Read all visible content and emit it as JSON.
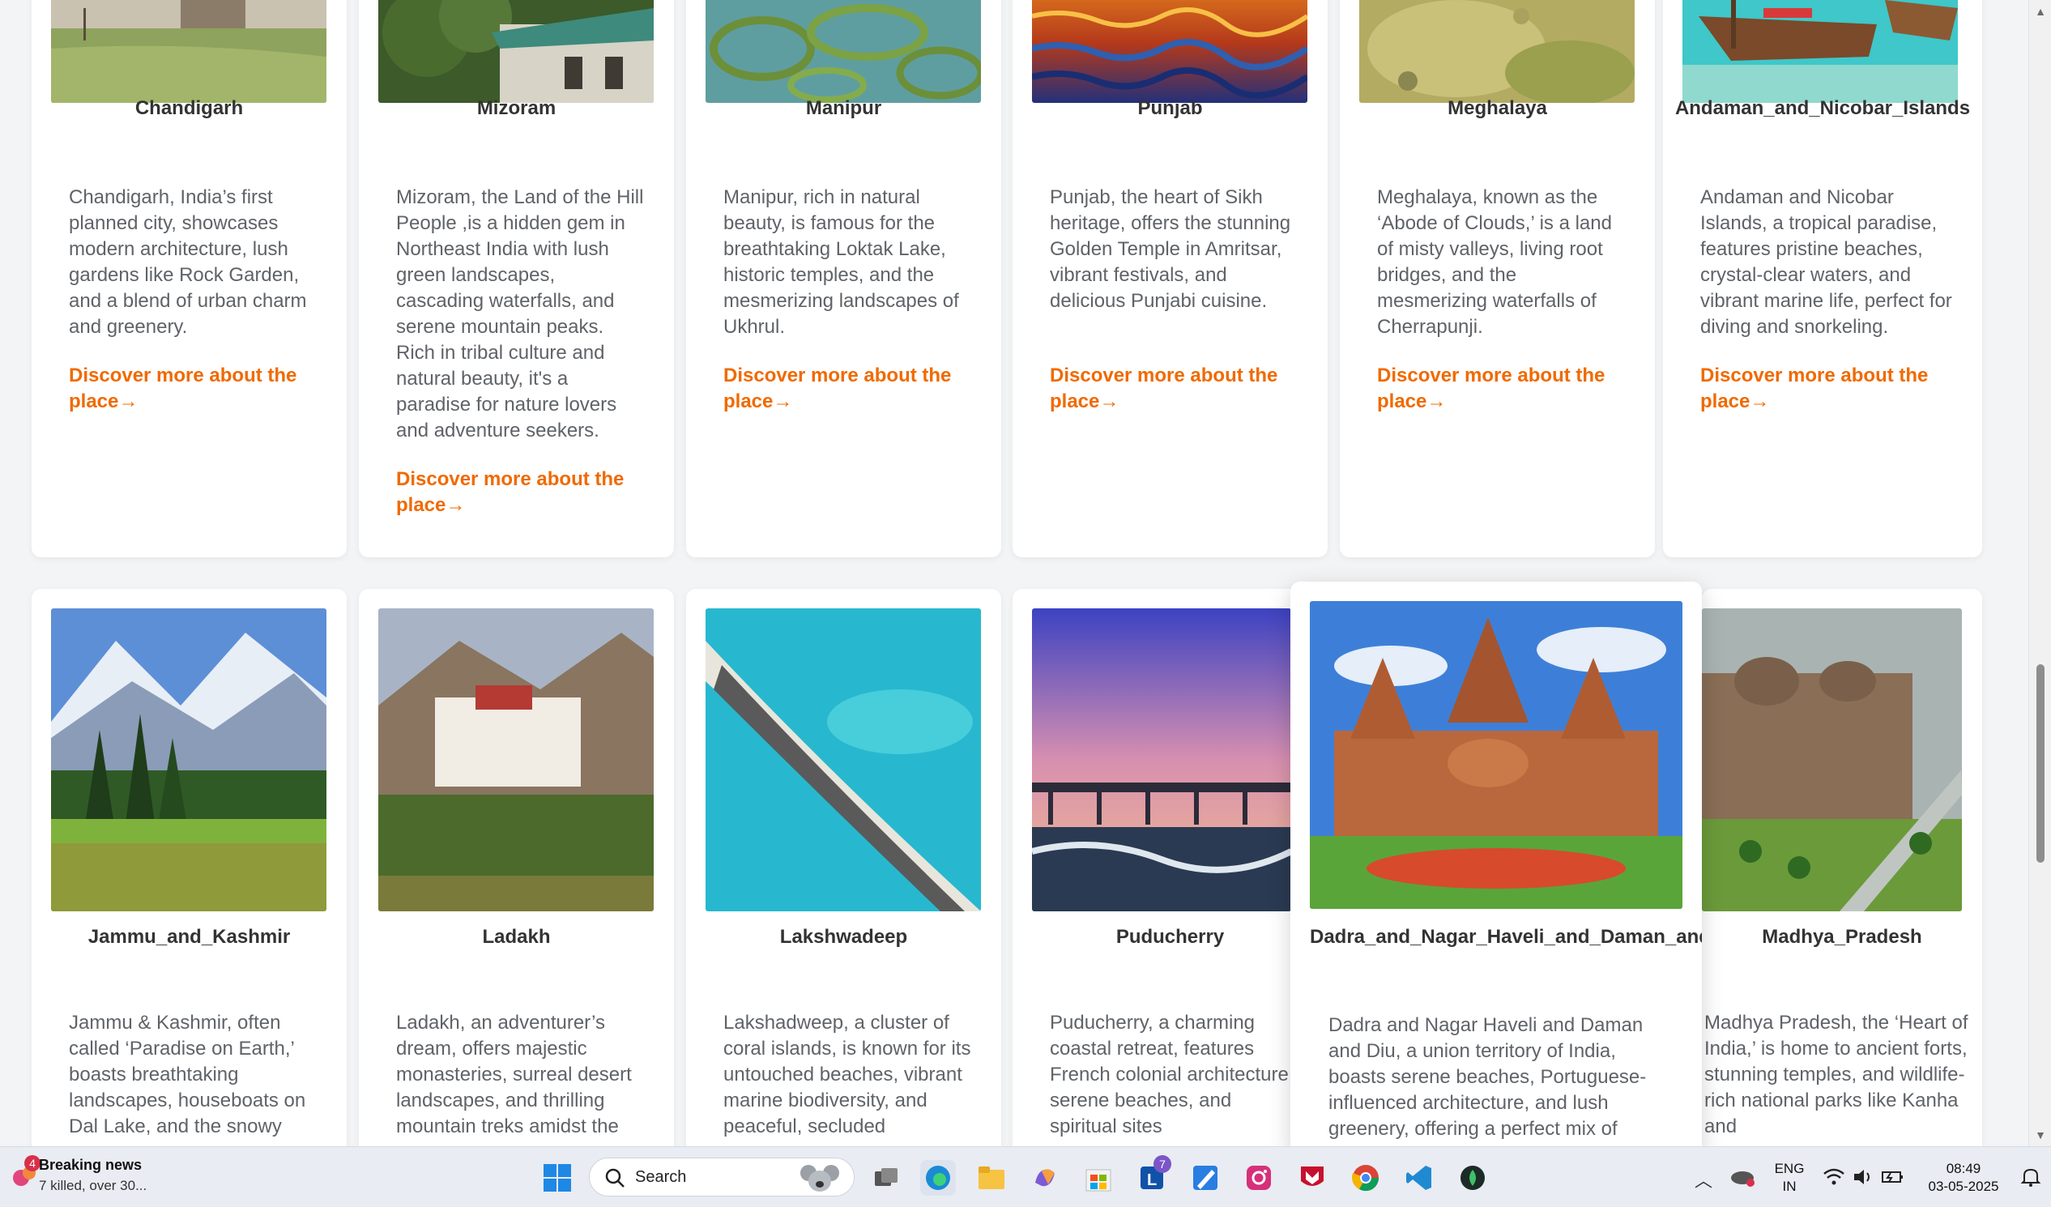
{
  "cards_row1": [
    {
      "title": "Chandigarh",
      "desc": "Chandigarh, India’s first planned city, showcases modern architecture, lush gardens like Rock Garden, and a blend of urban charm and greenery.",
      "link": "Discover more about the place→"
    },
    {
      "title": "Mizoram",
      "desc": "Mizoram, the Land of the Hill People ,is a hidden gem in Northeast India with lush green landscapes, cascading waterfalls, and serene mountain peaks. Rich in tribal culture and natural beauty, it's a paradise for nature lovers and adventure seekers.",
      "link": "Discover more about the place→"
    },
    {
      "title": "Manipur",
      "desc": "Manipur, rich in natural beauty, is famous for the breathtaking Loktak Lake, historic temples, and the mesmerizing landscapes of Ukhrul.",
      "link": "Discover more about the place→"
    },
    {
      "title": "Punjab",
      "desc": "Punjab, the heart of Sikh heritage, offers the stunning Golden Temple in Amritsar, vibrant festivals, and delicious Punjabi cuisine.",
      "link": "Discover more about the place→"
    },
    {
      "title": "Meghalaya",
      "desc": "Meghalaya, known as the ‘Abode of Clouds,’ is a land of misty valleys, living root bridges, and the mesmerizing waterfalls of Cherrapunji.",
      "link": "Discover more about the place→"
    },
    {
      "title": "Andaman_and_Nicobar_Islands",
      "desc": "Andaman and Nicobar Islands, a tropical paradise, features pristine beaches, crystal-clear waters, and vibrant marine life, perfect for diving and snorkeling.",
      "link": "Discover more about the place→"
    }
  ],
  "cards_row2": [
    {
      "title": "Jammu_and_Kashmir",
      "desc": "Jammu & Kashmir, often called ‘Paradise on Earth,’ boasts breathtaking landscapes, houseboats on Dal Lake, and the snowy"
    },
    {
      "title": "Ladakh",
      "desc": "Ladakh, an adventurer’s dream, offers majestic monasteries, surreal desert landscapes, and thrilling mountain treks amidst the"
    },
    {
      "title": "Lakshwadeep",
      "desc": "Lakshadweep, a cluster of coral islands, is known for its untouched beaches, vibrant marine biodiversity, and peaceful, secluded"
    },
    {
      "title": "Puducherry",
      "desc": "Puducherry, a charming coastal retreat, features French colonial architecture, serene beaches, and spiritual sites"
    },
    {
      "title": "Dadra_and_Nagar_Haveli_and_Daman_and",
      "desc": "Dadra and Nagar Haveli and Daman and Diu, a union territory of India, boasts serene beaches, Portuguese-influenced architecture, and lush greenery, offering a perfect mix of"
    },
    {
      "title": "Madhya_Pradesh",
      "desc": "Madhya Pradesh, the ‘Heart of India,’ is home to ancient forts, stunning temples, and wildlife-rich national parks like Kanha and"
    }
  ],
  "taskbar": {
    "news_title": "Breaking news",
    "news_sub": "7 killed, over 30...",
    "news_badge": "4",
    "search_label": "Search",
    "lang_top": "ENG",
    "lang_bottom": "IN",
    "time": "08:49",
    "date": "03-05-2025",
    "outlook_badge": "7"
  }
}
